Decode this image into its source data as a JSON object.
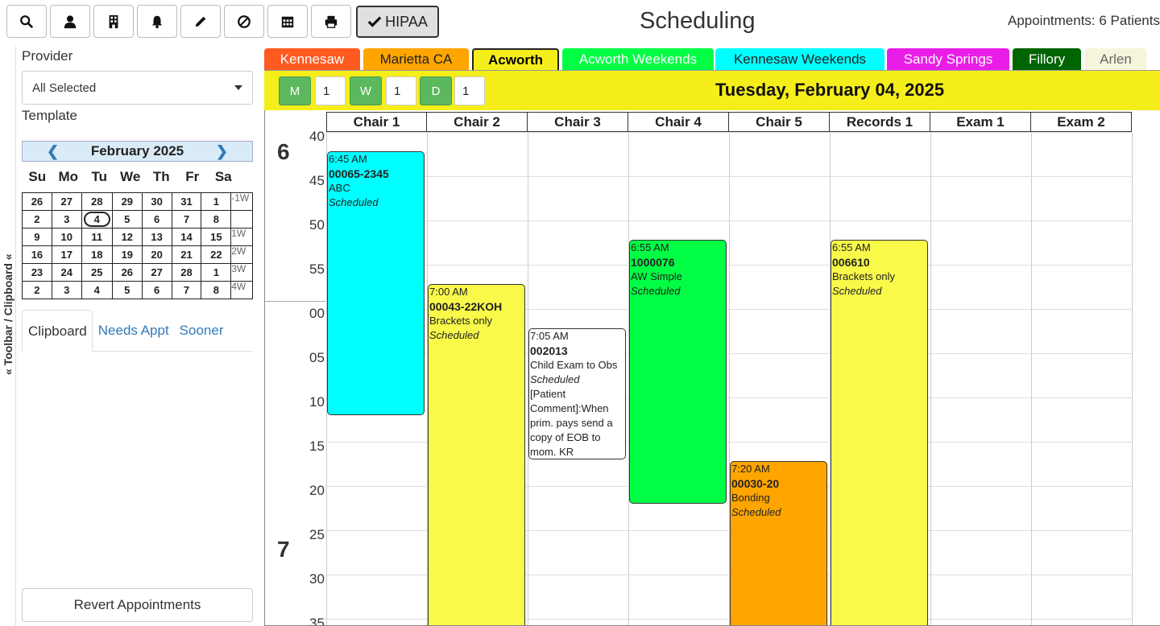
{
  "toolbar": {
    "buttons": [
      "search-icon",
      "user-icon",
      "building-icon",
      "bell-icon",
      "pencil-icon",
      "ban-icon",
      "calendar-icon",
      "print-icon"
    ],
    "hipaa_label": "HIPAA"
  },
  "header": {
    "title": "Scheduling",
    "appointments": "Appointments: 6 Patients"
  },
  "rail": {
    "label": "Toolbar / Clipboard"
  },
  "left": {
    "provider_label": "Provider",
    "provider_value": "All Selected",
    "template_label": "Template",
    "calendar": {
      "month": "February 2025",
      "dow": [
        "Su",
        "Mo",
        "Tu",
        "We",
        "Th",
        "Fr",
        "Sa"
      ],
      "weeks": [
        {
          "days": [
            "26",
            "27",
            "28",
            "29",
            "30",
            "31",
            "1"
          ],
          "tag": "-1W"
        },
        {
          "days": [
            "2",
            "3",
            "4",
            "5",
            "6",
            "7",
            "8"
          ],
          "tag": ""
        },
        {
          "days": [
            "9",
            "10",
            "11",
            "12",
            "13",
            "14",
            "15"
          ],
          "tag": "1W"
        },
        {
          "days": [
            "16",
            "17",
            "18",
            "19",
            "20",
            "21",
            "22"
          ],
          "tag": "2W"
        },
        {
          "days": [
            "23",
            "24",
            "25",
            "26",
            "27",
            "28",
            "1"
          ],
          "tag": "3W"
        },
        {
          "days": [
            "2",
            "3",
            "4",
            "5",
            "6",
            "7",
            "8"
          ],
          "tag": "4W"
        }
      ]
    },
    "tabs": [
      "Clipboard",
      "Needs Appt",
      "Sooner"
    ],
    "revert_label": "Revert Appointments"
  },
  "locations": [
    {
      "label": "Kennesaw",
      "bg": "#ff5a1f",
      "fg": "#ffffff"
    },
    {
      "label": "Marietta CA",
      "bg": "#ffa500",
      "fg": "#222222"
    },
    {
      "label": "Acworth",
      "bg": "#f5ee1a",
      "fg": "#000000"
    },
    {
      "label": "Acworth Weekends",
      "bg": "#00ff44",
      "fg": "#ffffff"
    },
    {
      "label": "Kennesaw Weekends",
      "bg": "#00ffff",
      "fg": "#222222"
    },
    {
      "label": "Sandy Springs",
      "bg": "#e81ee8",
      "fg": "#ffffff"
    },
    {
      "label": "Fillory",
      "bg": "#006400",
      "fg": "#ffffff"
    },
    {
      "label": "Arlen",
      "bg": "#f5f5dc",
      "fg": "#666666"
    }
  ],
  "datebar": {
    "m": "M",
    "m_val": "1",
    "w": "W",
    "w_val": "1",
    "d": "D",
    "d_val": "1",
    "date": "Tuesday, February 04, 2025"
  },
  "columns": [
    "Chair 1",
    "Chair 2",
    "Chair 3",
    "Chair 4",
    "Chair 5",
    "Records 1",
    "Exam 1",
    "Exam 2"
  ],
  "time_rows": [
    "40",
    "45",
    "50",
    "55",
    "00",
    "05",
    "10",
    "15",
    "20",
    "25",
    "30",
    "35"
  ],
  "hours": [
    "6",
    "7"
  ],
  "appointments": [
    {
      "col": 0,
      "time": "6:45 AM",
      "id": "00065-2345",
      "type": "ABC",
      "status": "Scheduled",
      "comment": "",
      "color": "#00ffff"
    },
    {
      "col": 1,
      "time": "7:00 AM",
      "id": "00043-22KOH",
      "type": "Brackets only",
      "status": "Scheduled",
      "comment": "",
      "color": "#f9f94a"
    },
    {
      "col": 2,
      "time": "7:05 AM",
      "id": "002013",
      "type": "Child Exam to Obs",
      "status": "Scheduled",
      "comment": "[Patient Comment]:When prim. pays send a copy of EOB to mom. KR",
      "color": "#ffffff"
    },
    {
      "col": 3,
      "time": "6:55 AM",
      "id": "1000076",
      "type": "AW Simple",
      "status": "Scheduled",
      "comment": "",
      "color": "#00ff44"
    },
    {
      "col": 4,
      "time": "7:20 AM",
      "id": "00030-20",
      "type": "Bonding",
      "status": "Scheduled",
      "comment": "",
      "color": "#ffa500"
    },
    {
      "col": 5,
      "time": "6:55 AM",
      "id": "006610",
      "type": "Brackets only",
      "status": "Scheduled",
      "comment": "",
      "color": "#f9f94a"
    }
  ]
}
